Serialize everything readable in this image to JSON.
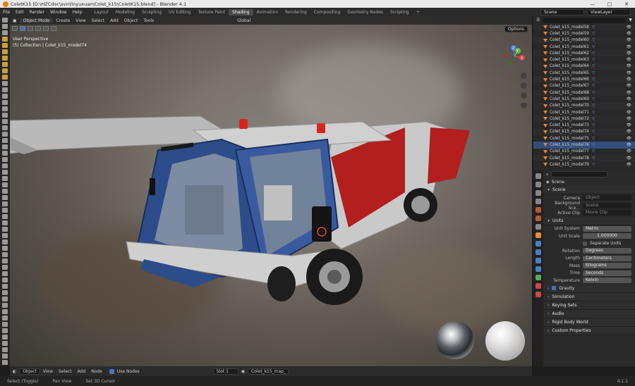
{
  "window": {
    "title": "ColetK15 [D:\\HZCdoc\\svn\\linyuxuan\\Colet_k15\\ColetK15.blend] - Blender 4.1",
    "controls": [
      "—",
      "□",
      "✕"
    ]
  },
  "topbar": {
    "menus": [
      "File",
      "Edit",
      "Render",
      "Window",
      "Help"
    ],
    "workspaces": [
      "Layout",
      "Modeling",
      "Sculpting",
      "UV Editing",
      "Texture Paint",
      "Shading",
      "Animation",
      "Rendering",
      "Compositing",
      "Geometry Nodes",
      "Scripting"
    ],
    "active_workspace": "Shading",
    "add_tab": "+",
    "scene": "Scene",
    "view_layer": "ViewLayer"
  },
  "viewport": {
    "mode": "Object Mode",
    "menus": [
      "Create",
      "View",
      "Select",
      "Add",
      "Object",
      "Tools"
    ],
    "orientation": "Global",
    "options": "Options",
    "perspective": "User Perspective",
    "collection": "(5) Collection | Colet_k15_model74"
  },
  "gizmo": {
    "x": "X",
    "y": "Y",
    "z": "Z"
  },
  "viewport_footer": {
    "editor_type": "Object",
    "menus": [
      "View",
      "Select",
      "Add",
      "Node"
    ],
    "use_nodes": "Use Nodes",
    "slot": "Slot 1",
    "material": "Colet_k15_map_"
  },
  "statusbar": {
    "items": [
      "Select (Toggle)",
      "Pan View",
      "Set 3D Cursor"
    ],
    "version": "4.1.1"
  },
  "outliner": {
    "rows": [
      "Colet_k15_model58",
      "Colet_k15_model59",
      "Colet_k15_model60",
      "Colet_k15_model61",
      "Colet_k15_model62",
      "Colet_k15_model63",
      "Colet_k15_model64",
      "Colet_k15_model65",
      "Colet_k15_model66",
      "Colet_k15_model67",
      "Colet_k15_model68",
      "Colet_k15_model69",
      "Colet_k15_model70",
      "Colet_k15_model71",
      "Colet_k15_model72",
      "Colet_k15_model73",
      "Colet_k15_model74",
      "Colet_k15_model75",
      "Colet_k15_model76",
      "Colet_k15_model77",
      "Colet_k15_model78",
      "Colet_k15_model79"
    ],
    "selected": "Colet_k15_model76"
  },
  "properties": {
    "header": "Scene",
    "scene_section": "Scene",
    "camera_label": "Camera",
    "camera_placeholder": "Object",
    "bg_scene_label": "Background Sce...",
    "bg_scene_placeholder": "Scene",
    "active_clip_label": "Active Clip",
    "active_clip_placeholder": "Movie Clip",
    "units_section": "Units",
    "unit_system_label": "Unit System",
    "unit_system": "Metric",
    "unit_scale_label": "Unit Scale",
    "unit_scale": "1.000000",
    "separate_units": "Separate Units",
    "rotation_label": "Rotation",
    "rotation": "Degrees",
    "length_label": "Length",
    "length": "Centimeters",
    "mass_label": "Mass",
    "mass": "Kilograms",
    "time_label": "Time",
    "time": "Seconds",
    "temperature_label": "Temperature",
    "temperature": "Kelvin",
    "collapsed": [
      "Gravity",
      "Simulation",
      "Keying Sets",
      "Audio",
      "Rigid Body World",
      "Custom Properties"
    ]
  },
  "colors": {
    "accent": "#4772b3",
    "selected_row": "#334d80",
    "truck_blue": "#2d4d8a",
    "truck_red": "#b31e1e"
  }
}
